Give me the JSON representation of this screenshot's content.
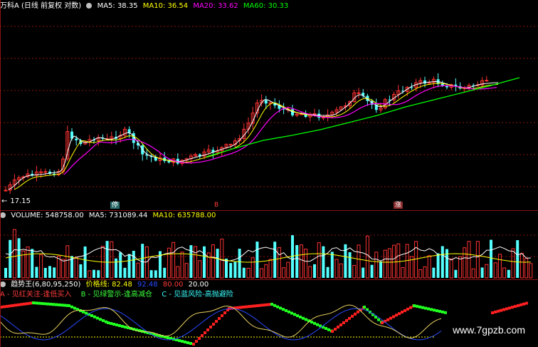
{
  "price_panel": {
    "title": "万科A (日线 前复权 对数)",
    "ma5": "MA5: 38.35",
    "ma10": "MA10: 36.54",
    "ma20": "MA20: 33.62",
    "ma60": "MA60: 30.33",
    "low_label": "17.15",
    "markers": [
      {
        "text": "停"
      },
      {
        "text": "B"
      },
      {
        "text": "涨"
      }
    ]
  },
  "volume_panel": {
    "title": "VOLUME: 548758.00",
    "ma5": "MA5: 731089.44",
    "ma10": "MA10: 635788.00"
  },
  "indicator_panel": {
    "title": "趋势王(6,80,95,250)",
    "price_line": "价格线: 82.48",
    "v1": "92.48",
    "v2": "80.00",
    "v3": "20.00",
    "legend_a": "A - 见红关注-逢低买入",
    "legend_b": "B - 见绿警示-逢高减仓",
    "legend_c": "C - 见蓝风险-高抛避险"
  },
  "watermark": "www.7gpzb.com",
  "colors": {
    "up": "#ff3232",
    "down": "#54ffff",
    "ma5": "#ffffff",
    "ma10": "#ffff00",
    "ma20": "#ff00ff",
    "ma60": "#00ff00",
    "grid": "#8a1414"
  }
}
